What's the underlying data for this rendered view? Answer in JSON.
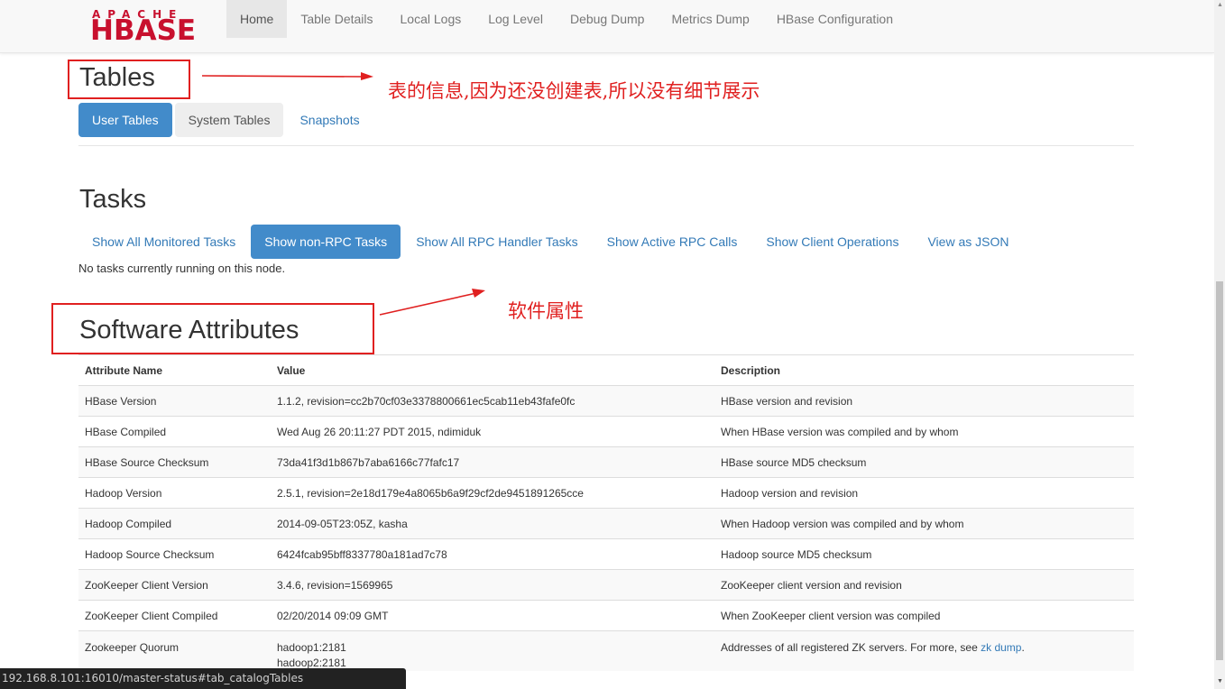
{
  "logo": {
    "small": "APACHE",
    "big": "HBASE"
  },
  "nav": {
    "items": [
      {
        "label": "Home"
      },
      {
        "label": "Table Details"
      },
      {
        "label": "Local Logs"
      },
      {
        "label": "Log Level"
      },
      {
        "label": "Debug Dump"
      },
      {
        "label": "Metrics Dump"
      },
      {
        "label": "HBase Configuration"
      }
    ]
  },
  "tables": {
    "heading": "Tables",
    "tabs": [
      {
        "label": "User Tables"
      },
      {
        "label": "System Tables"
      },
      {
        "label": "Snapshots"
      }
    ]
  },
  "tasks": {
    "heading": "Tasks",
    "tabs": [
      {
        "label": "Show All Monitored Tasks"
      },
      {
        "label": "Show non-RPC Tasks"
      },
      {
        "label": "Show All RPC Handler Tasks"
      },
      {
        "label": "Show Active RPC Calls"
      },
      {
        "label": "Show Client Operations"
      },
      {
        "label": "View as JSON"
      }
    ],
    "empty_text": "No tasks currently running on this node."
  },
  "annotations": {
    "tables_note": "表的信息,因为还没创建表,所以没有细节展示",
    "software_note": "软件属性"
  },
  "software": {
    "heading": "Software Attributes",
    "columns": [
      "Attribute Name",
      "Value",
      "Description"
    ],
    "rows": [
      {
        "name": "HBase Version",
        "value": "1.1.2, revision=cc2b70cf03e3378800661ec5cab11eb43fafe0fc",
        "desc": "HBase version and revision"
      },
      {
        "name": "HBase Compiled",
        "value": "Wed Aug 26 20:11:27 PDT 2015, ndimiduk",
        "desc": "When HBase version was compiled and by whom"
      },
      {
        "name": "HBase Source Checksum",
        "value": "73da41f3d1b867b7aba6166c77fafc17",
        "desc": "HBase source MD5 checksum"
      },
      {
        "name": "Hadoop Version",
        "value": "2.5.1, revision=2e18d179e4a8065b6a9f29cf2de9451891265cce",
        "desc": "Hadoop version and revision"
      },
      {
        "name": "Hadoop Compiled",
        "value": "2014-09-05T23:05Z, kasha",
        "desc": "When Hadoop version was compiled and by whom"
      },
      {
        "name": "Hadoop Source Checksum",
        "value": "6424fcab95bff8337780a181ad7c78",
        "desc": "Hadoop source MD5 checksum"
      },
      {
        "name": "ZooKeeper Client Version",
        "value": "3.4.6, revision=1569965",
        "desc": "ZooKeeper client version and revision"
      },
      {
        "name": "ZooKeeper Client Compiled",
        "value": "02/20/2014 09:09 GMT",
        "desc": "When ZooKeeper client version was compiled"
      }
    ],
    "quorum": {
      "name": "Zookeeper Quorum",
      "values": [
        "hadoop1:2181",
        "hadoop2:2181"
      ],
      "desc": "Addresses of all registered ZK servers. For more, see ",
      "link": "zk dump",
      "desc_end": "."
    }
  },
  "status_url": "192.168.8.101:16010/master-status#tab_catalogTables",
  "colors": {
    "accent": "#428bca",
    "link": "#337ab7",
    "annotation": "#e02020",
    "brand": "#c8102e"
  }
}
